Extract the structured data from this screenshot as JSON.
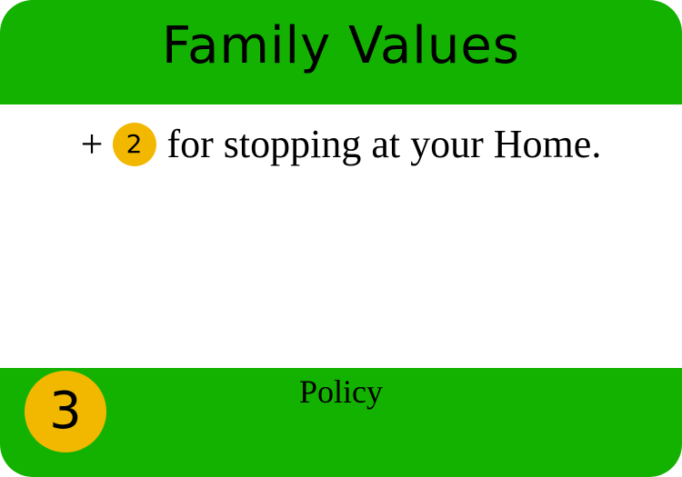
{
  "card": {
    "title": "Family Values",
    "rule": {
      "prefix": "+",
      "value": "2",
      "text": "for stopping at your Home."
    },
    "type": "Policy",
    "cost": "3"
  },
  "colors": {
    "band": "#13b200",
    "chip": "#f2b800",
    "text": "#000000",
    "body": "#ffffff"
  }
}
